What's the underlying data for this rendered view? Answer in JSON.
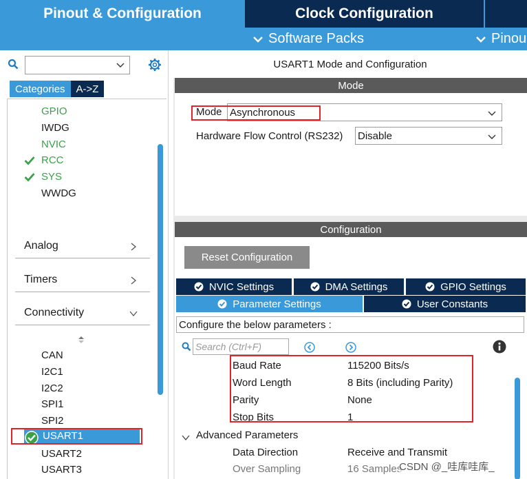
{
  "top_tabs": {
    "pinout": "Pinout & Configuration",
    "clock": "Clock Configuration",
    "software_packs": "Software Packs",
    "pinout_view": "Pinou"
  },
  "sidebar": {
    "category_tabs": [
      "Categories",
      "A->Z"
    ],
    "system_core_items": [
      {
        "label": "GPIO",
        "state": "green"
      },
      {
        "label": "IWDG",
        "state": "normal"
      },
      {
        "label": "NVIC",
        "state": "green"
      },
      {
        "label": "RCC",
        "state": "checked"
      },
      {
        "label": "SYS",
        "state": "checked"
      },
      {
        "label": "WWDG",
        "state": "normal"
      }
    ],
    "groups": [
      "Analog",
      "Timers",
      "Connectivity"
    ],
    "connectivity_items": [
      "CAN",
      "I2C1",
      "I2C2",
      "SPI1",
      "SPI2",
      "USART1",
      "USART2",
      "USART3"
    ],
    "selected": "USART1"
  },
  "panel": {
    "title": "USART1 Mode and Configuration",
    "mode_header": "Mode",
    "mode_label": "Mode",
    "mode_value": "Asynchronous",
    "flow_label": "Hardware Flow Control (RS232)",
    "flow_value": "Disable",
    "config_header": "Configuration",
    "reset_button": "Reset Configuration",
    "tabs_row1": [
      "NVIC Settings",
      "DMA Settings",
      "GPIO Settings"
    ],
    "tabs_row2": [
      "Parameter Settings",
      "User Constants"
    ],
    "active_tab": "Parameter Settings",
    "hint": "Configure the below parameters :",
    "search_placeholder": "Search (Ctrl+F)",
    "params": [
      {
        "name": "Baud Rate",
        "value": "115200 Bits/s"
      },
      {
        "name": "Word Length",
        "value": "8 Bits (including Parity)"
      },
      {
        "name": "Parity",
        "value": "None"
      },
      {
        "name": "Stop Bits",
        "value": "1"
      }
    ],
    "advanced_label": "Advanced Parameters",
    "advanced_params": [
      {
        "name": "Data Direction",
        "value": "Receive and Transmit"
      },
      {
        "name": "Over Sampling",
        "value": "16 Samples"
      }
    ]
  },
  "watermark": "CSDN @_哇库哇库_",
  "colors": {
    "accent": "#3a9ad9",
    "dark": "#0b2a52",
    "green": "#3aa04a",
    "highlight": "#e0232a"
  }
}
